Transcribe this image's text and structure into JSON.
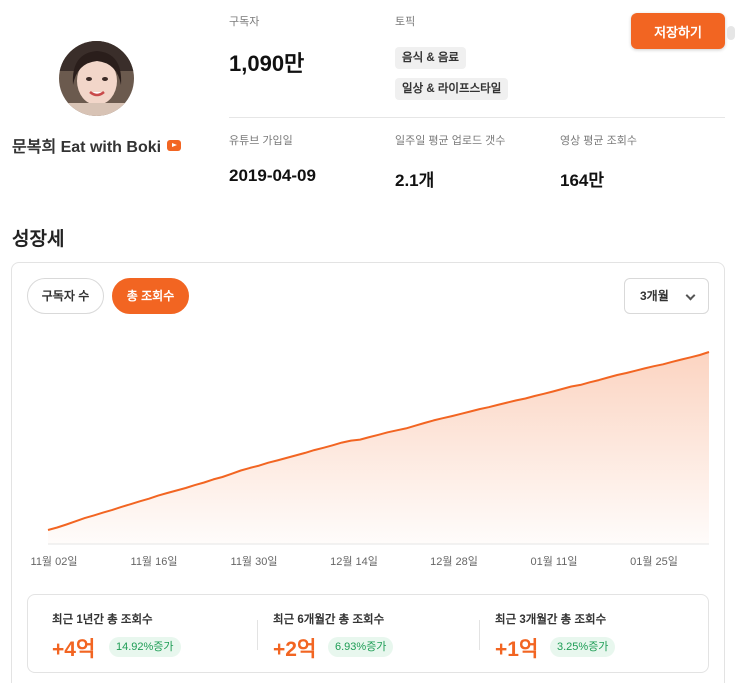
{
  "profile": {
    "channel_name": "문복희 Eat with Boki",
    "youtube_icon": "youtube-play-icon"
  },
  "stats": {
    "subscribers_label": "구독자",
    "subscribers_value": "1,090만",
    "topic_label": "토픽",
    "topics": [
      "음식 & 음료",
      "일상 & 라이프스타일"
    ],
    "joined_label": "유튜브 가입일",
    "joined_value": "2019-04-09",
    "uploads_label": "일주일 평균 업로드 갯수",
    "uploads_value": "2.1개",
    "avg_views_label": "영상 평균 조회수",
    "avg_views_value": "164만"
  },
  "actions": {
    "save_label": "저장하기"
  },
  "growth": {
    "title": "성장세",
    "tabs": [
      "구독자 수",
      "총 조회수"
    ],
    "active_tab": "총 조회수",
    "period_value": "3개월"
  },
  "colors": {
    "accent": "#f26522",
    "badge_green": "#1e9d55",
    "badge_bg": "#e8f7ee"
  },
  "chart_data": {
    "type": "area",
    "x_ticks": [
      "11월 02일",
      "11월 16일",
      "11월 30일",
      "12월 14일",
      "12월 28일",
      "01월 11일",
      "01월 25일"
    ],
    "series": [
      {
        "values": [
          0,
          1.4,
          3.1,
          4.9,
          6.7,
          8.2,
          9.8,
          11.3,
          13.0,
          14.5,
          16.1,
          17.6,
          19.3,
          20.8,
          22.2,
          23.6,
          25.2,
          26.7,
          28.4,
          29.8,
          31.6,
          33.4,
          34.9,
          36.2,
          37.8,
          39.1,
          40.5,
          41.9,
          43.3,
          44.9,
          46.2,
          47.6,
          49.1,
          50.2,
          50.8,
          52.2,
          53.5,
          54.9,
          56.0,
          57.1,
          58.6,
          60.1,
          61.6,
          62.8,
          64.0,
          65.3,
          66.6,
          67.9,
          69.0,
          70.3,
          71.6,
          72.8,
          73.9,
          75.3,
          76.5,
          77.8,
          79.2,
          80.6,
          81.5,
          83.0,
          84.2,
          85.7,
          87.1,
          88.2,
          89.5,
          90.8,
          92.0,
          93.1,
          94.5,
          95.8,
          97.0,
          98.3,
          100
        ]
      }
    ],
    "x_range": [
      "11월 02일",
      "02월 01일"
    ],
    "y_axis_shown": false,
    "grid": false,
    "legend": "none"
  },
  "summary": [
    {
      "label": "최근 1년간 총 조회수",
      "value": "+4억",
      "badge": "14.92%증가"
    },
    {
      "label": "최근 6개월간 총 조회수",
      "value": "+2억",
      "badge": "6.93%증가"
    },
    {
      "label": "최근 3개월간 총 조회수",
      "value": "+1억",
      "badge": "3.25%증가"
    }
  ]
}
